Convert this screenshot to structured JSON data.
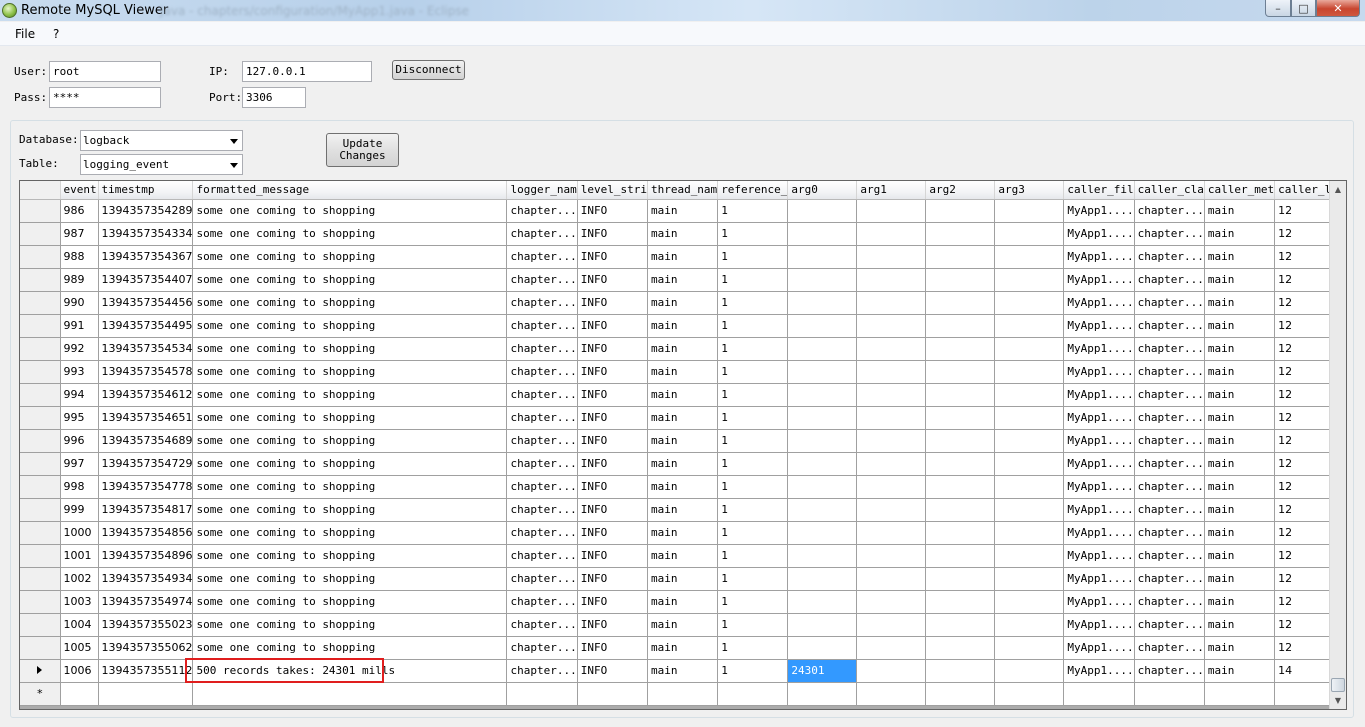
{
  "window": {
    "title": "Remote MySQL Viewer",
    "bg_title": "Java - chapters/configuration/MyApp1.java - Eclipse"
  },
  "menu": [
    "File",
    "?"
  ],
  "connection": {
    "user_label": "User:",
    "user_value": "root",
    "pass_label": "Pass:",
    "pass_value": "****",
    "ip_label": "IP:",
    "ip_value": "127.0.0.1",
    "port_label": "Port:",
    "port_value": "3306",
    "disconnect_label": "Disconnect"
  },
  "selection": {
    "database_label": "Database:",
    "database_value": "logback",
    "table_label": "Table:",
    "table_value": "logging_event",
    "update_label_line1": "Update",
    "update_label_line2": "Changes"
  },
  "grid": {
    "columns": [
      "event",
      "timestmp",
      "formatted_message",
      "logger_nam",
      "level_stri",
      "thread_nam",
      "reference_",
      "arg0",
      "arg1",
      "arg2",
      "arg3",
      "caller_fil",
      "caller_cla",
      "caller_met",
      "caller_lin"
    ],
    "rows": [
      [
        "986",
        "1394357354289",
        "some one coming to shopping",
        "chapter...",
        "INFO",
        "main",
        "1",
        "",
        "",
        "",
        "",
        "MyApp1....",
        "chapter...",
        "main",
        "12"
      ],
      [
        "987",
        "1394357354334",
        "some one coming to shopping",
        "chapter...",
        "INFO",
        "main",
        "1",
        "",
        "",
        "",
        "",
        "MyApp1....",
        "chapter...",
        "main",
        "12"
      ],
      [
        "988",
        "1394357354367",
        "some one coming to shopping",
        "chapter...",
        "INFO",
        "main",
        "1",
        "",
        "",
        "",
        "",
        "MyApp1....",
        "chapter...",
        "main",
        "12"
      ],
      [
        "989",
        "1394357354407",
        "some one coming to shopping",
        "chapter...",
        "INFO",
        "main",
        "1",
        "",
        "",
        "",
        "",
        "MyApp1....",
        "chapter...",
        "main",
        "12"
      ],
      [
        "990",
        "1394357354456",
        "some one coming to shopping",
        "chapter...",
        "INFO",
        "main",
        "1",
        "",
        "",
        "",
        "",
        "MyApp1....",
        "chapter...",
        "main",
        "12"
      ],
      [
        "991",
        "1394357354495",
        "some one coming to shopping",
        "chapter...",
        "INFO",
        "main",
        "1",
        "",
        "",
        "",
        "",
        "MyApp1....",
        "chapter...",
        "main",
        "12"
      ],
      [
        "992",
        "1394357354534",
        "some one coming to shopping",
        "chapter...",
        "INFO",
        "main",
        "1",
        "",
        "",
        "",
        "",
        "MyApp1....",
        "chapter...",
        "main",
        "12"
      ],
      [
        "993",
        "1394357354578",
        "some one coming to shopping",
        "chapter...",
        "INFO",
        "main",
        "1",
        "",
        "",
        "",
        "",
        "MyApp1....",
        "chapter...",
        "main",
        "12"
      ],
      [
        "994",
        "1394357354612",
        "some one coming to shopping",
        "chapter...",
        "INFO",
        "main",
        "1",
        "",
        "",
        "",
        "",
        "MyApp1....",
        "chapter...",
        "main",
        "12"
      ],
      [
        "995",
        "1394357354651",
        "some one coming to shopping",
        "chapter...",
        "INFO",
        "main",
        "1",
        "",
        "",
        "",
        "",
        "MyApp1....",
        "chapter...",
        "main",
        "12"
      ],
      [
        "996",
        "1394357354689",
        "some one coming to shopping",
        "chapter...",
        "INFO",
        "main",
        "1",
        "",
        "",
        "",
        "",
        "MyApp1....",
        "chapter...",
        "main",
        "12"
      ],
      [
        "997",
        "1394357354729",
        "some one coming to shopping",
        "chapter...",
        "INFO",
        "main",
        "1",
        "",
        "",
        "",
        "",
        "MyApp1....",
        "chapter...",
        "main",
        "12"
      ],
      [
        "998",
        "1394357354778",
        "some one coming to shopping",
        "chapter...",
        "INFO",
        "main",
        "1",
        "",
        "",
        "",
        "",
        "MyApp1....",
        "chapter...",
        "main",
        "12"
      ],
      [
        "999",
        "1394357354817",
        "some one coming to shopping",
        "chapter...",
        "INFO",
        "main",
        "1",
        "",
        "",
        "",
        "",
        "MyApp1....",
        "chapter...",
        "main",
        "12"
      ],
      [
        "1000",
        "1394357354856",
        "some one coming to shopping",
        "chapter...",
        "INFO",
        "main",
        "1",
        "",
        "",
        "",
        "",
        "MyApp1....",
        "chapter...",
        "main",
        "12"
      ],
      [
        "1001",
        "1394357354896",
        "some one coming to shopping",
        "chapter...",
        "INFO",
        "main",
        "1",
        "",
        "",
        "",
        "",
        "MyApp1....",
        "chapter...",
        "main",
        "12"
      ],
      [
        "1002",
        "1394357354934",
        "some one coming to shopping",
        "chapter...",
        "INFO",
        "main",
        "1",
        "",
        "",
        "",
        "",
        "MyApp1....",
        "chapter...",
        "main",
        "12"
      ],
      [
        "1003",
        "1394357354974",
        "some one coming to shopping",
        "chapter...",
        "INFO",
        "main",
        "1",
        "",
        "",
        "",
        "",
        "MyApp1....",
        "chapter...",
        "main",
        "12"
      ],
      [
        "1004",
        "1394357355023",
        "some one coming to shopping",
        "chapter...",
        "INFO",
        "main",
        "1",
        "",
        "",
        "",
        "",
        "MyApp1....",
        "chapter...",
        "main",
        "12"
      ],
      [
        "1005",
        "1394357355062",
        "some one coming to shopping",
        "chapter...",
        "INFO",
        "main",
        "1",
        "",
        "",
        "",
        "",
        "MyApp1....",
        "chapter...",
        "main",
        "12"
      ],
      [
        "1006",
        "1394357355112",
        "500 records takes: 24301 mills",
        "chapter...",
        "INFO",
        "main",
        "1",
        "24301",
        "",
        "",
        "",
        "MyApp1....",
        "chapter...",
        "main",
        "14"
      ]
    ],
    "current_row_marker": "▶",
    "new_row_marker": "*",
    "selected_cell_value": "24301"
  },
  "icons": {
    "app": "mysql-dolphin-icon",
    "minimize": "minimize-icon",
    "maximize": "maximize-icon",
    "close": "close-icon"
  },
  "colors": {
    "selection": "#3399ff",
    "highlight_box": "#e01e1e"
  }
}
